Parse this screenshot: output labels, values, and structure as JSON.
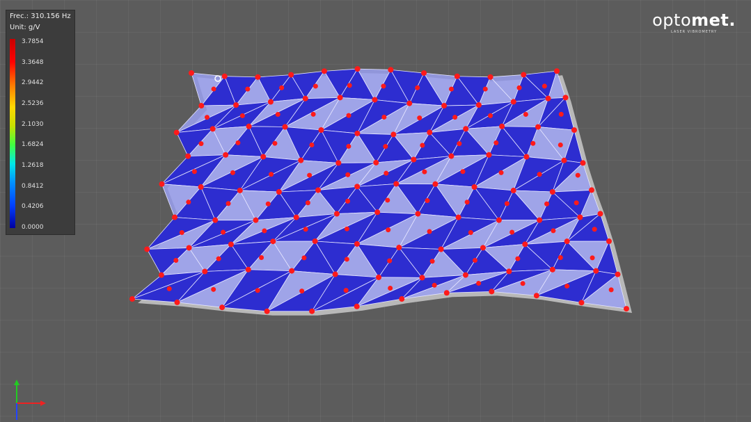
{
  "legend": {
    "freq_label": "Frec.: 310.156 Hz",
    "unit_label": "Unit: g/V",
    "ticks": [
      "3.7854",
      "3.3648",
      "2.9442",
      "2.5236",
      "2.1030",
      "1.6824",
      "1.2618",
      "0.8412",
      "0.4206",
      "0.0000"
    ],
    "colors": {
      "max": "#c80000",
      "mid": "#ffd800",
      "low": "#0040ff",
      "min": "#0000a0"
    }
  },
  "logo": {
    "brand_light": "opto",
    "brand_bold": "met.",
    "tagline": "LASER VIBROMETRY"
  },
  "mesh": {
    "fill_color": "#2d2dd0",
    "overlay_color": "#9aa0f0",
    "point_color": "#ff1a1a",
    "line_color": "#e6e6ff"
  },
  "axes": {
    "y_color": "#22cc22",
    "x_color": "#ee2222",
    "z_color": "#2244ff"
  }
}
